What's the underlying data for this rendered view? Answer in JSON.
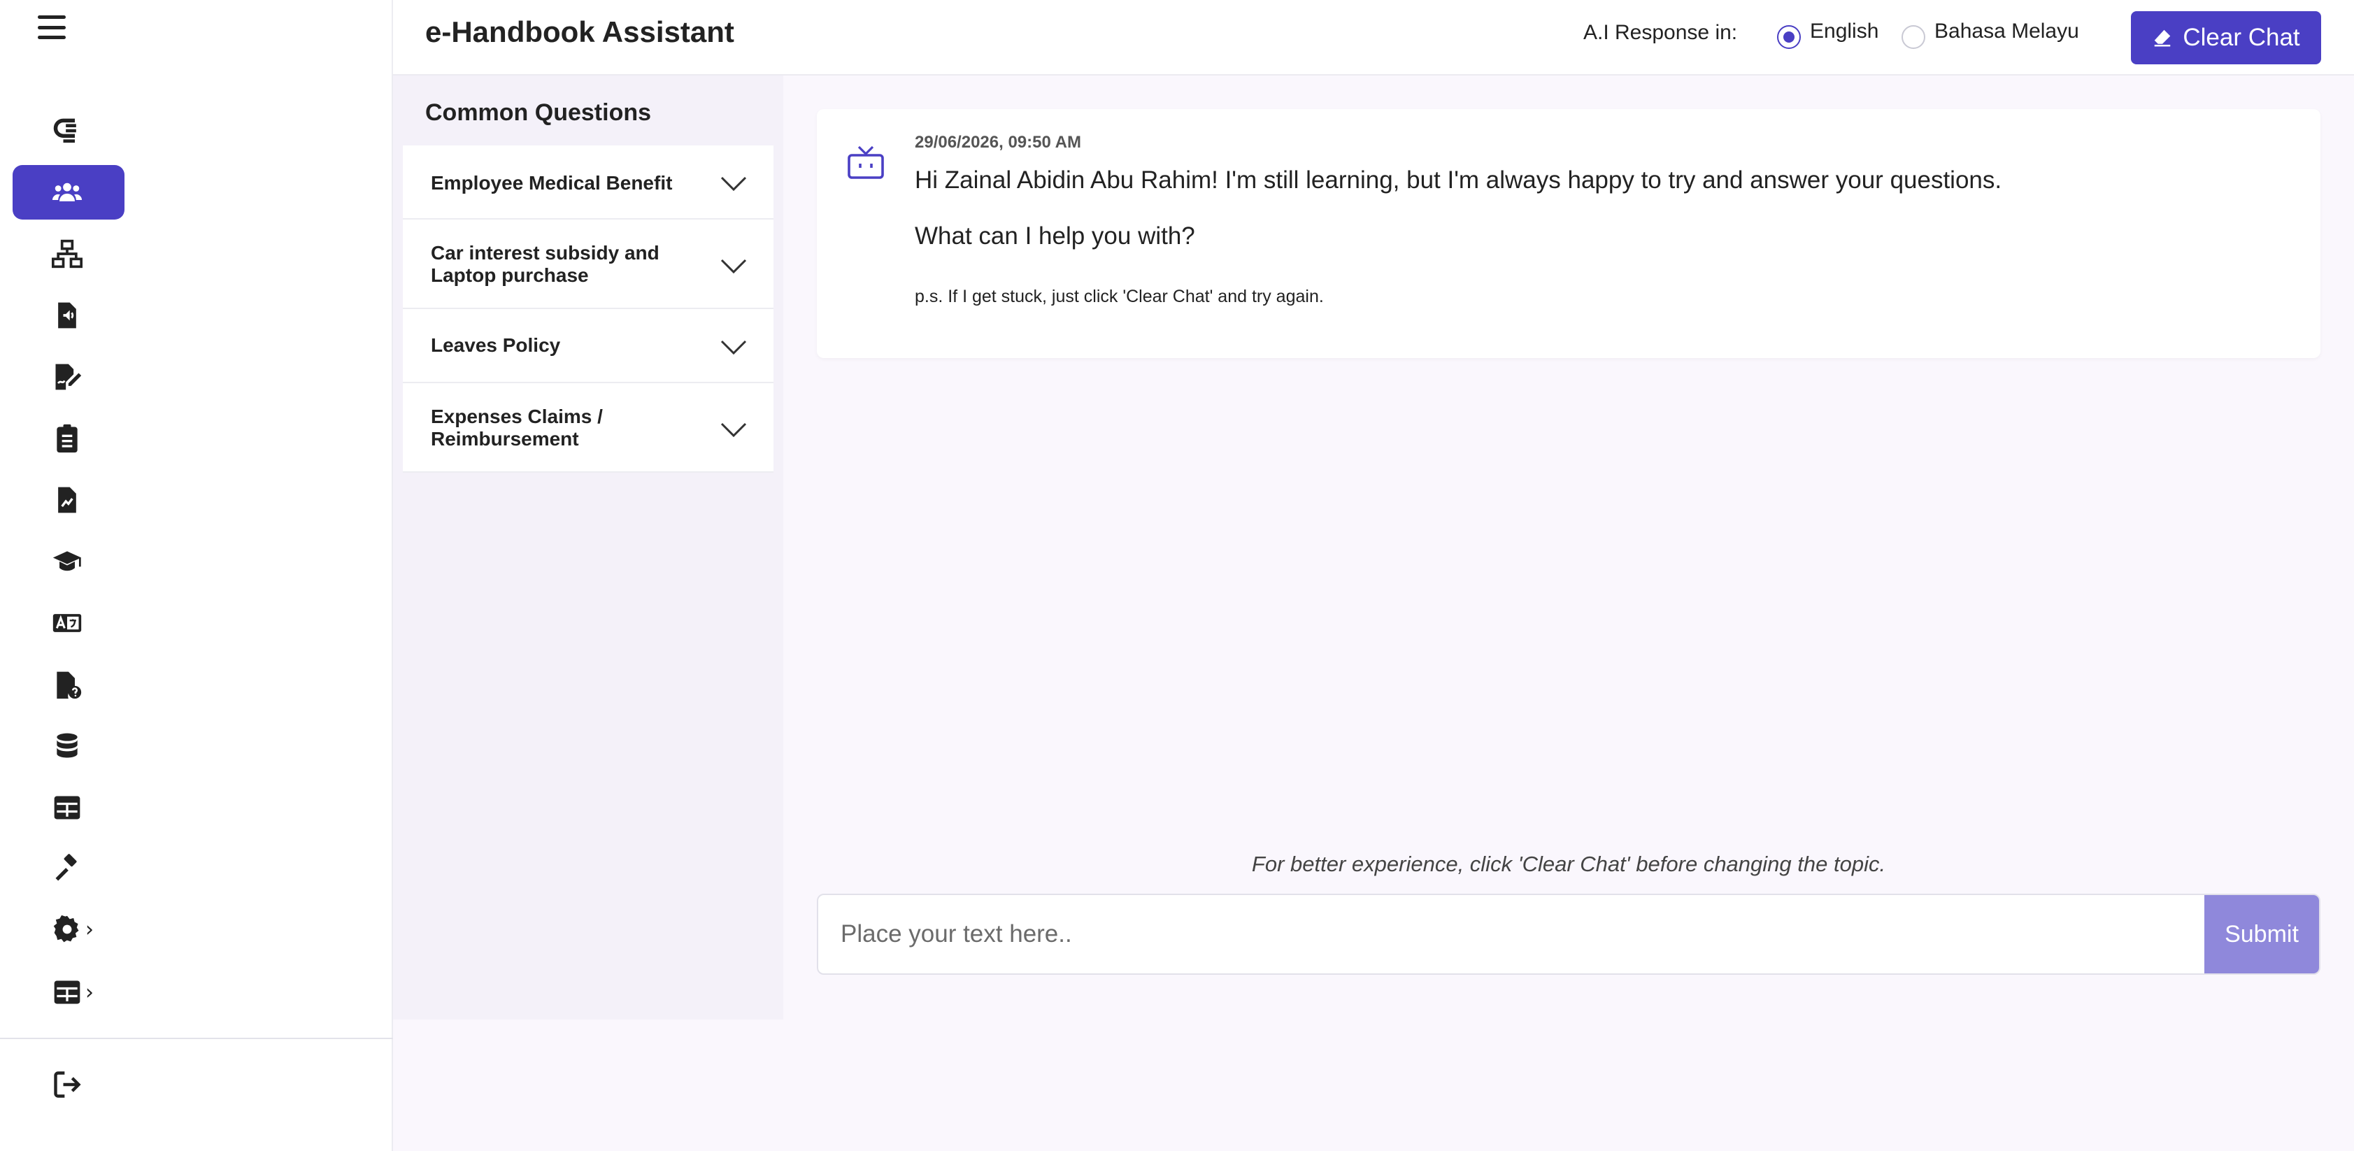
{
  "header": {
    "title": "e-Handbook Assistant",
    "ai_response_label": "A.I Response in:",
    "languages": [
      {
        "label": "English",
        "selected": true
      },
      {
        "label": "Bahasa Melayu",
        "selected": false
      }
    ],
    "clear_chat_label": "Clear Chat"
  },
  "sidebar": {
    "items": [
      {
        "icon": "logo-icon",
        "active": false
      },
      {
        "icon": "users-icon",
        "active": true
      },
      {
        "icon": "sitemap-icon",
        "active": false
      },
      {
        "icon": "audio-file-icon",
        "active": false
      },
      {
        "icon": "file-signature-icon",
        "active": false
      },
      {
        "icon": "clipboard-list-icon",
        "active": false
      },
      {
        "icon": "file-chart-icon",
        "active": false
      },
      {
        "icon": "graduation-cap-icon",
        "active": false
      },
      {
        "icon": "translate-icon",
        "active": false
      },
      {
        "icon": "file-question-icon",
        "active": false
      },
      {
        "icon": "database-icon",
        "active": false
      },
      {
        "icon": "table-icon",
        "active": false
      },
      {
        "icon": "gavel-icon",
        "active": false
      },
      {
        "icon": "gear-icon",
        "active": false,
        "expandable": true
      },
      {
        "icon": "table-icon",
        "active": false,
        "expandable": true
      },
      {
        "icon": "logout-icon",
        "active": false
      }
    ],
    "expand_glyph": "›"
  },
  "common_questions": {
    "title": "Common Questions",
    "items": [
      {
        "label": "Employee Medical Benefit"
      },
      {
        "label": "Car interest subsidy and Laptop purchase"
      },
      {
        "label": "Leaves Policy"
      },
      {
        "label": "Expenses Claims / Reimbursement"
      }
    ]
  },
  "chat": {
    "messages": [
      {
        "timestamp": "29/06/2026, 09:50 AM",
        "greeting": "Hi Zainal Abidin Abu Rahim! I'm still learning, but I'm always happy to try and answer your questions.",
        "prompt": "What can I help you with?",
        "ps": "p.s. If I get stuck, just click 'Clear Chat' and try again."
      }
    ],
    "hint": "For better experience, click 'Clear Chat' before changing the topic.",
    "input_placeholder": "Place your text here..",
    "input_value": "",
    "submit_label": "Submit"
  },
  "colors": {
    "accent": "#4a3fc4",
    "submit_disabled": "#8f88db",
    "page_bg": "#faf7fd"
  }
}
